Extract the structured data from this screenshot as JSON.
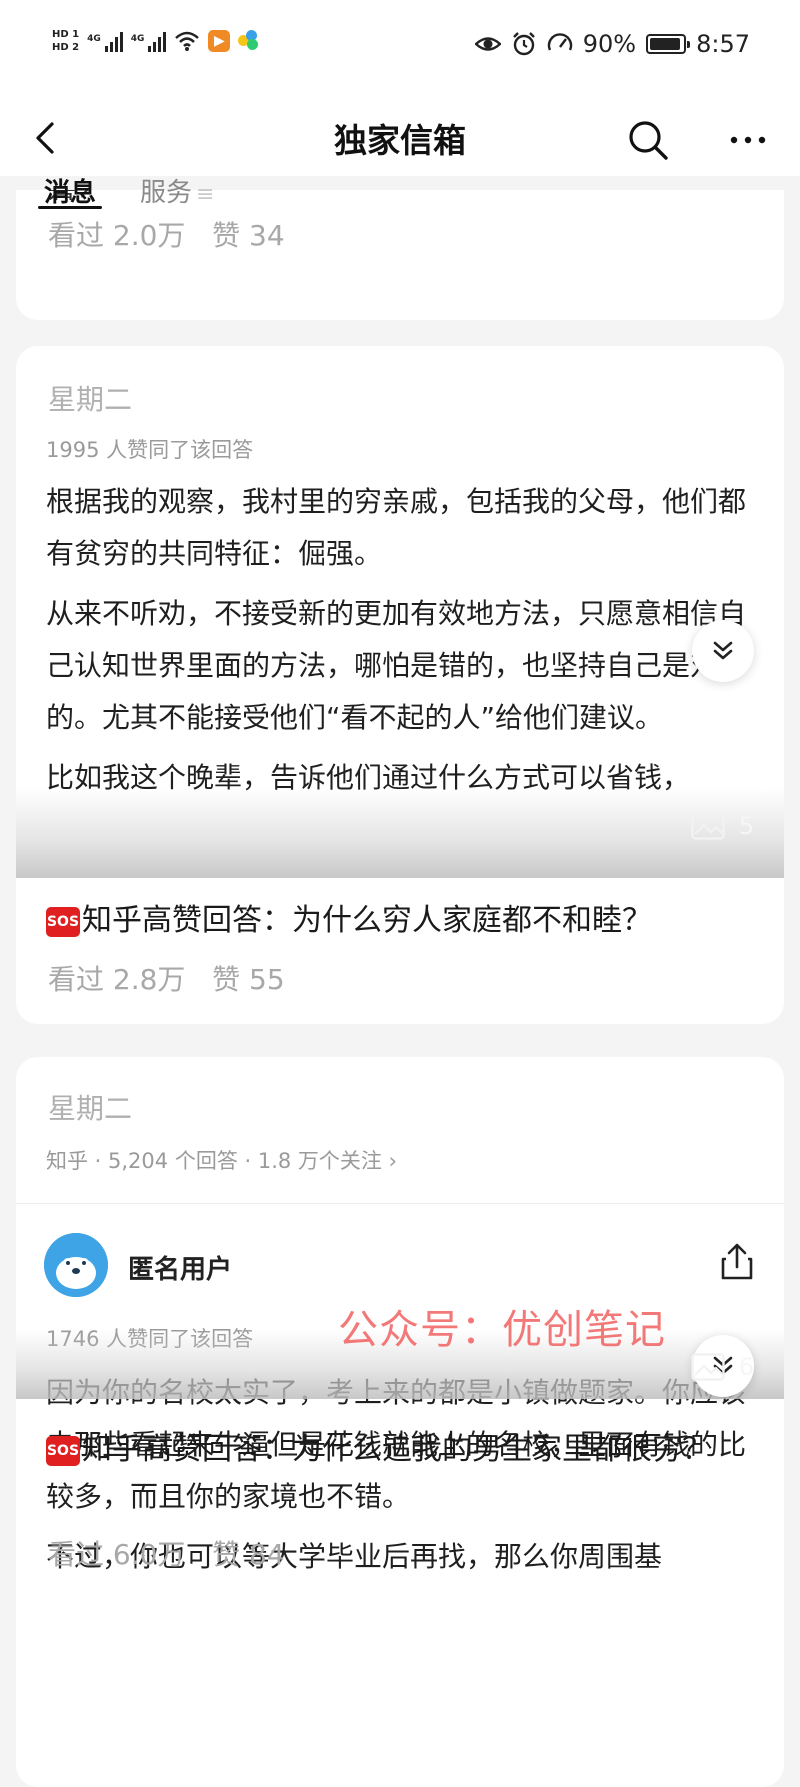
{
  "status_bar": {
    "sim1": "HD 1",
    "sim2": "HD 2",
    "net1": "4G",
    "net2": "4G",
    "battery": "90%",
    "time": "8:57",
    "icons": [
      "eye-icon",
      "alarm-icon",
      "speed-icon",
      "wifi-icon"
    ]
  },
  "nav": {
    "title": "独家信箱"
  },
  "tabs": {
    "messages": "消息",
    "services": "服务",
    "services_suffix": "≡"
  },
  "card0": {
    "cut_text": "看？",
    "views": "看过 2.0万",
    "likes": "赞 34"
  },
  "card1": {
    "day": "星期二",
    "agree": "1995 人赞同了该回答",
    "paragraphs": [
      "根据我的观察，我村里的穷亲戚，包括我的父母，他们都有贫穷的共同特征：倔强。",
      "从来不听劝，不接受新的更加有效地方法，只愿意相信自己认知世界里面的方法，哪怕是错的，也坚持自己是对的。尤其不能接受他们“看不起的人”给他们建议。",
      "比如我这个晚辈，告诉他们通过什么方式可以省钱，"
    ],
    "image_count": "5",
    "sos": "SOS",
    "title": "知乎高赞回答：为什么穷人家庭都不和睦？",
    "views": "看过 2.8万",
    "likes": "赞 55"
  },
  "card2": {
    "day": "星期二",
    "meta": "知乎 · 5,204 个回答 · 1.8 万个关注",
    "meta_chevron": "›",
    "username": "匿名用户",
    "agree": "1746 人赞同了该回答",
    "paragraphs": [
      "因为你的名校太实了，考上来的都是小镇做题家。你应该去那些看起来牛逼但是花钱就能上的名校，里面有钱的比较多，而且你的家境也不错。",
      "不过，你也可以等大学毕业后再找，那么你周围基"
    ],
    "image_count": "6",
    "sos": "SOS",
    "title": "知乎高赞回答：为什么追我的男生家里都很穷？",
    "views": "看过 6.0万",
    "likes": "赞 84"
  },
  "watermark": "公众号：优创笔记"
}
